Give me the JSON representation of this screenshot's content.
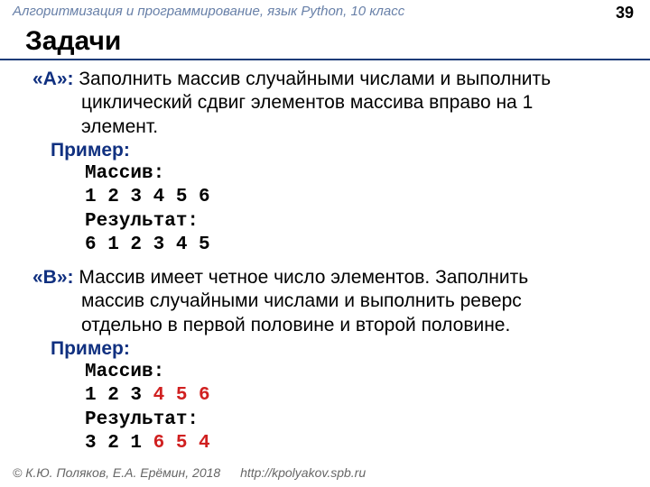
{
  "header": {
    "course": "Алгоритмизация и программирование, язык Python, 10 класс",
    "page": "39"
  },
  "title": "Задачи",
  "tasks": {
    "a": {
      "label": "«A»:",
      "desc_first": " Заполнить массив случайными числами и выполнить",
      "desc_cont1": "циклический сдвиг элементов массива вправо на 1",
      "desc_cont2": "элемент.",
      "example_label": "Пример:",
      "arr_label": "Массив:",
      "arr_values": "1 2 3 4 5 6",
      "res_label": "Результат:",
      "res_values": "6 1 2 3 4 5"
    },
    "b": {
      "label": "«B»:",
      "desc_first": " Массив имеет четное число элементов. Заполнить",
      "desc_cont1": "массив случайными числами и выполнить реверс",
      "desc_cont2": "отдельно в первой половине и второй половине.",
      "example_label": "Пример:",
      "arr_label": "Массив:",
      "arr_black": "1 2 3 ",
      "arr_red": "4 5 6",
      "res_label": "Результат:",
      "res_black": "3 2 1 ",
      "res_red": "6 5 4"
    }
  },
  "footer": {
    "copyright": "© К.Ю. Поляков, Е.А. Ерёмин, 2018",
    "url": "http://kpolyakov.spb.ru"
  }
}
